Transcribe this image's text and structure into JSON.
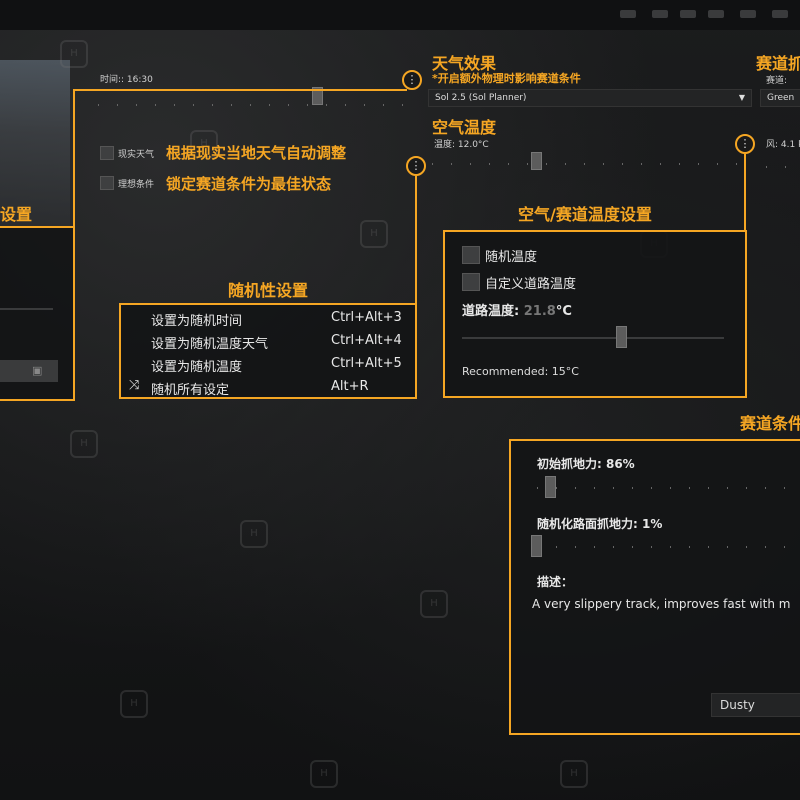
{
  "colors": {
    "accent": "#f5a623",
    "panel_bg": "#141516"
  },
  "top": {
    "time_label": "时间:: 16:30"
  },
  "weather_effects": {
    "title": "天气效果",
    "subtitle": "*开启额外物理时影响赛道条件",
    "dropdown_value": "Sol 2.5 (Sol Planner)"
  },
  "track_right": {
    "title": "赛道抓",
    "track_label": "赛道:",
    "track_value": "Green",
    "wind_label": "风: 4.1 k"
  },
  "air_temp": {
    "title": "空气温度",
    "value_label": "温度: 12.0°C"
  },
  "weather_options": {
    "real_weather_label": "现实天气",
    "real_weather_ann": "根据现实当地天气自动调整",
    "ideal_label": "理想条件",
    "ideal_ann": "锁定赛道条件为最佳状态"
  },
  "left_panel": {
    "title_fragment": "设置"
  },
  "random_settings": {
    "title": "随机性设置",
    "items": [
      {
        "label": "设置为随机时间",
        "shortcut": "Ctrl+Alt+3",
        "icon": ""
      },
      {
        "label": "设置为随机温度天气",
        "shortcut": "Ctrl+Alt+4",
        "icon": ""
      },
      {
        "label": "设置为随机温度",
        "shortcut": "Ctrl+Alt+5",
        "icon": ""
      },
      {
        "label": "随机所有设定",
        "shortcut": "Alt+R",
        "icon": "shuffle-icon"
      }
    ]
  },
  "temp_settings": {
    "title": "空气/赛道温度设置",
    "random_temp_label": "随机温度",
    "custom_road_label": "自定义道路温度",
    "road_temp_label": "道路温度:",
    "road_temp_value": "21.8",
    "road_temp_unit": "°C",
    "recommended": "Recommended: 15°C"
  },
  "track_conditions": {
    "title": "赛道条件",
    "initial_grip_label": "初始抓地力: 86%",
    "initial_grip_level": 0.86,
    "random_grip_label": "随机化路面抓地力: 1%",
    "random_grip_level": 0.01,
    "desc_label": "描述：",
    "desc_text": "A very slippery track, improves fast with m",
    "preset_value": "Dusty"
  }
}
